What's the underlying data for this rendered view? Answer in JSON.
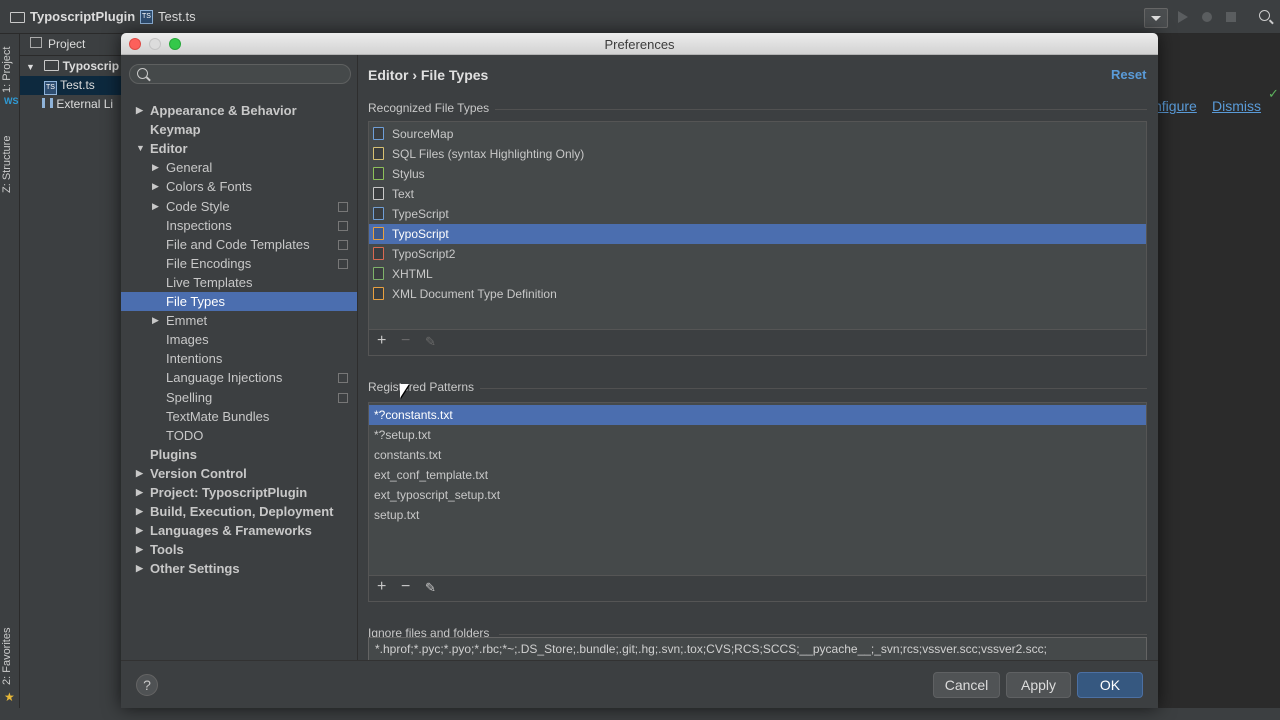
{
  "ide": {
    "project_crumb": "TyposcriptPlugin",
    "file_crumb": "Test.ts",
    "side_tab_project": "1: Project",
    "side_tab_structure": "Z: Structure",
    "side_tab_favorites": "2: Favorites",
    "project_pane_title": "Project",
    "tree": [
      {
        "label": "Typoscrip",
        "icon": "folder-icon"
      },
      {
        "label": "Test.ts",
        "icon": "ts-file-icon"
      },
      {
        "label": "External Li",
        "icon": "library-icon"
      }
    ],
    "notify_configure": "nfigure",
    "notify_dismiss": "Dismiss"
  },
  "dialog": {
    "title": "Preferences",
    "search_placeholder": "",
    "breadcrumb": "Editor › File Types",
    "reset_label": "Reset"
  },
  "sidebar": {
    "items": [
      {
        "label": "Appearance & Behavior",
        "level": 0,
        "arrow": "right",
        "bold": true,
        "selected": false,
        "copy": false
      },
      {
        "label": "Keymap",
        "level": 0,
        "arrow": "none",
        "bold": true,
        "selected": false,
        "copy": false
      },
      {
        "label": "Editor",
        "level": 0,
        "arrow": "down",
        "bold": true,
        "selected": false,
        "copy": false
      },
      {
        "label": "General",
        "level": 1,
        "arrow": "right",
        "bold": false,
        "selected": false,
        "copy": false
      },
      {
        "label": "Colors & Fonts",
        "level": 1,
        "arrow": "right",
        "bold": false,
        "selected": false,
        "copy": false
      },
      {
        "label": "Code Style",
        "level": 1,
        "arrow": "right",
        "bold": false,
        "selected": false,
        "copy": true
      },
      {
        "label": "Inspections",
        "level": 1,
        "arrow": "none",
        "bold": false,
        "selected": false,
        "copy": true
      },
      {
        "label": "File and Code Templates",
        "level": 1,
        "arrow": "none",
        "bold": false,
        "selected": false,
        "copy": true
      },
      {
        "label": "File Encodings",
        "level": 1,
        "arrow": "none",
        "bold": false,
        "selected": false,
        "copy": true
      },
      {
        "label": "Live Templates",
        "level": 1,
        "arrow": "none",
        "bold": false,
        "selected": false,
        "copy": false
      },
      {
        "label": "File Types",
        "level": 1,
        "arrow": "none",
        "bold": false,
        "selected": true,
        "copy": false
      },
      {
        "label": "Emmet",
        "level": 1,
        "arrow": "right",
        "bold": false,
        "selected": false,
        "copy": false
      },
      {
        "label": "Images",
        "level": 1,
        "arrow": "none",
        "bold": false,
        "selected": false,
        "copy": false
      },
      {
        "label": "Intentions",
        "level": 1,
        "arrow": "none",
        "bold": false,
        "selected": false,
        "copy": false
      },
      {
        "label": "Language Injections",
        "level": 1,
        "arrow": "none",
        "bold": false,
        "selected": false,
        "copy": true
      },
      {
        "label": "Spelling",
        "level": 1,
        "arrow": "none",
        "bold": false,
        "selected": false,
        "copy": true
      },
      {
        "label": "TextMate Bundles",
        "level": 1,
        "arrow": "none",
        "bold": false,
        "selected": false,
        "copy": false
      },
      {
        "label": "TODO",
        "level": 1,
        "arrow": "none",
        "bold": false,
        "selected": false,
        "copy": false
      },
      {
        "label": "Plugins",
        "level": 0,
        "arrow": "none",
        "bold": true,
        "selected": false,
        "copy": false
      },
      {
        "label": "Version Control",
        "level": 0,
        "arrow": "right",
        "bold": true,
        "selected": false,
        "copy": false
      },
      {
        "label": "Project: TyposcriptPlugin",
        "level": 0,
        "arrow": "right",
        "bold": true,
        "selected": false,
        "copy": false
      },
      {
        "label": "Build, Execution, Deployment",
        "level": 0,
        "arrow": "right",
        "bold": true,
        "selected": false,
        "copy": false
      },
      {
        "label": "Languages & Frameworks",
        "level": 0,
        "arrow": "right",
        "bold": true,
        "selected": false,
        "copy": false
      },
      {
        "label": "Tools",
        "level": 0,
        "arrow": "right",
        "bold": true,
        "selected": false,
        "copy": false
      },
      {
        "label": "Other Settings",
        "level": 0,
        "arrow": "right",
        "bold": true,
        "selected": false,
        "copy": false
      }
    ]
  },
  "recognized": {
    "label": "Recognized File Types",
    "items": [
      {
        "label": "SourceMap",
        "icon": "sourcemap-file-icon",
        "color": "#6e9ed8",
        "selected": false
      },
      {
        "label": "SQL Files (syntax Highlighting Only)",
        "icon": "sql-file-icon",
        "color": "#d8c070",
        "selected": false
      },
      {
        "label": "Stylus",
        "icon": "stylus-file-icon",
        "color": "#8dbf5a",
        "selected": false
      },
      {
        "label": "Text",
        "icon": "text-file-icon",
        "color": "#c8c8c8",
        "selected": false
      },
      {
        "label": "TypeScript",
        "icon": "typescript-file-icon",
        "color": "#6e9ed8",
        "selected": false
      },
      {
        "label": "TypoScript",
        "icon": "typoscript-file-icon",
        "color": "#e8a040",
        "selected": true
      },
      {
        "label": "TypoScript2",
        "icon": "typoscript2-file-icon",
        "color": "#d86a50",
        "selected": false
      },
      {
        "label": "XHTML",
        "icon": "xhtml-file-icon",
        "color": "#7fb26a",
        "selected": false
      },
      {
        "label": "XML Document Type Definition",
        "icon": "dtd-file-icon",
        "color": "#e8a040",
        "selected": false
      }
    ]
  },
  "patterns": {
    "label": "Registered Patterns",
    "items": [
      {
        "label": "*?constants.txt",
        "selected": true
      },
      {
        "label": "*?setup.txt",
        "selected": false
      },
      {
        "label": "constants.txt",
        "selected": false
      },
      {
        "label": "ext_conf_template.txt",
        "selected": false
      },
      {
        "label": "ext_typoscript_setup.txt",
        "selected": false
      },
      {
        "label": "setup.txt",
        "selected": false
      }
    ]
  },
  "ignore": {
    "label": "Ignore files and folders",
    "value": "*.hprof;*.pyc;*.pyo;*.rbc;*~;.DS_Store;.bundle;.git;.hg;.svn;.tox;CVS;RCS;SCCS;__pycache__;_svn;rcs;vssver.scc;vssver2.scc;"
  },
  "footer": {
    "help_label": "?",
    "cancel_label": "Cancel",
    "apply_label": "Apply",
    "ok_label": "OK"
  },
  "colors": {
    "selection": "#4b6eaf",
    "link": "#5a9bd8",
    "primary_button": "#365880"
  }
}
